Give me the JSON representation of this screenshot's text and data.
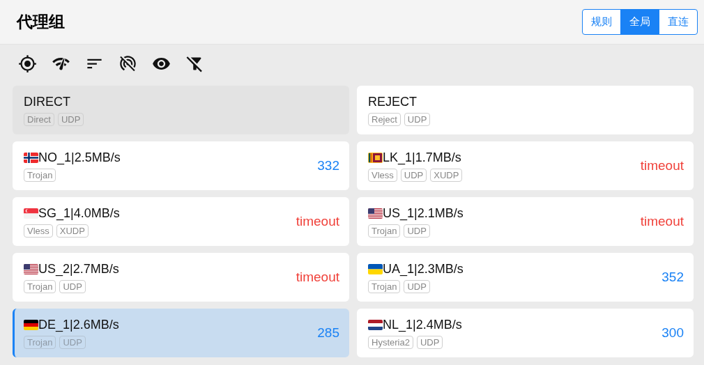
{
  "title": "代理组",
  "modes": [
    {
      "label": "规则",
      "selected": false
    },
    {
      "label": "全局",
      "selected": true
    },
    {
      "label": "直连",
      "selected": false
    }
  ],
  "proxies": [
    {
      "name": "DIRECT",
      "kind": "plain",
      "tags": [
        "Direct",
        "UDP"
      ],
      "selected": false,
      "disabled": true
    },
    {
      "name": "REJECT",
      "kind": "plain",
      "tags": [
        "Reject",
        "UDP"
      ],
      "selected": false,
      "disabled": false
    },
    {
      "name": "NO_1|2.5MB/s",
      "kind": "norway",
      "tags": [
        "Trojan"
      ],
      "delay": "332",
      "color": "#1a82f5",
      "selected": false,
      "disabled": false
    },
    {
      "name": "LK_1|1.7MB/s",
      "kind": "srilanka",
      "tags": [
        "Vless",
        "UDP",
        "XUDP"
      ],
      "delay": "timeout",
      "color": "#f0413a",
      "selected": false,
      "disabled": false
    },
    {
      "name": "SG_1|4.0MB/s",
      "kind": "singapore",
      "tags": [
        "Vless",
        "XUDP"
      ],
      "delay": "timeout",
      "color": "#f0413a",
      "selected": false,
      "disabled": false
    },
    {
      "name": "US_1|2.1MB/s",
      "kind": "usa",
      "tags": [
        "Trojan",
        "UDP"
      ],
      "delay": "timeout",
      "color": "#f0413a",
      "selected": false,
      "disabled": false
    },
    {
      "name": "US_2|2.7MB/s",
      "kind": "usa",
      "tags": [
        "Trojan",
        "UDP"
      ],
      "delay": "timeout",
      "color": "#f0413a",
      "selected": false,
      "disabled": false
    },
    {
      "name": "UA_1|2.3MB/s",
      "kind": "ukraine",
      "tags": [
        "Trojan",
        "UDP"
      ],
      "delay": "352",
      "color": "#1a82f5",
      "selected": false,
      "disabled": false
    },
    {
      "name": "DE_1|2.6MB/s",
      "kind": "germany",
      "tags": [
        "Trojan",
        "UDP"
      ],
      "delay": "285",
      "color": "#1a82f5",
      "selected": true,
      "disabled": false
    },
    {
      "name": "NL_1|2.4MB/s",
      "kind": "netherlands",
      "tags": [
        "Hysteria2",
        "UDP"
      ],
      "delay": "300",
      "color": "#1a82f5",
      "selected": false,
      "disabled": false
    }
  ]
}
